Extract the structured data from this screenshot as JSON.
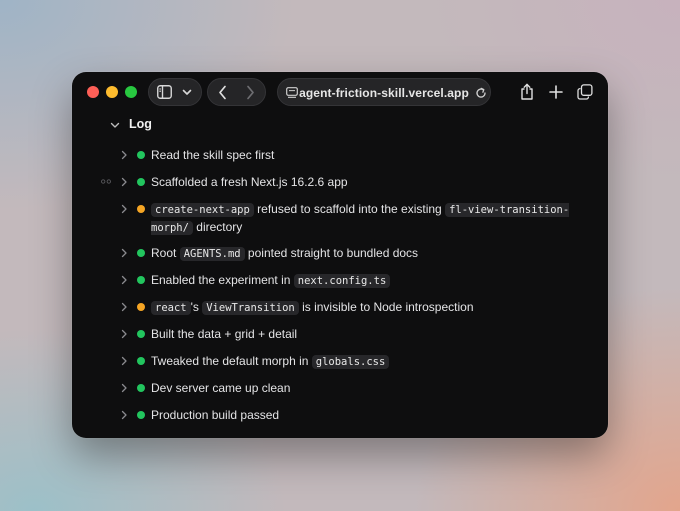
{
  "browser": {
    "url": "agent-friction-skill.vercel.app"
  },
  "log": {
    "title": "Log",
    "items": [
      {
        "status": "green",
        "parts": [
          {
            "t": "Read the skill spec first"
          }
        ]
      },
      {
        "status": "green",
        "parts": [
          {
            "t": "Scaffolded a fresh Next.js 16.2.6 app"
          }
        ]
      },
      {
        "status": "amber",
        "parts": [
          {
            "t": "create-next-app",
            "code": true
          },
          {
            "t": " refused to scaffold into the existing "
          },
          {
            "t": "fl-view-transition-morph/",
            "code": true
          },
          {
            "t": " directory"
          }
        ]
      },
      {
        "status": "green",
        "parts": [
          {
            "t": "Root "
          },
          {
            "t": "AGENTS.md",
            "code": true
          },
          {
            "t": " pointed straight to bundled docs"
          }
        ]
      },
      {
        "status": "green",
        "parts": [
          {
            "t": "Enabled the experiment in "
          },
          {
            "t": "next.config.ts",
            "code": true
          }
        ]
      },
      {
        "status": "amber",
        "parts": [
          {
            "t": "react",
            "code": true
          },
          {
            "t": "'s "
          },
          {
            "t": "ViewTransition",
            "code": true
          },
          {
            "t": " is invisible to Node introspection"
          }
        ]
      },
      {
        "status": "green",
        "parts": [
          {
            "t": "Built the data + grid + detail"
          }
        ]
      },
      {
        "status": "green",
        "parts": [
          {
            "t": "Tweaked the default morph in "
          },
          {
            "t": "globals.css",
            "code": true
          }
        ]
      },
      {
        "status": "green",
        "parts": [
          {
            "t": "Dev server came up clean"
          }
        ]
      },
      {
        "status": "green",
        "parts": [
          {
            "t": "Production build passed"
          }
        ]
      }
    ]
  },
  "colors": {
    "green": "#22c55e",
    "amber": "#f5a524"
  }
}
